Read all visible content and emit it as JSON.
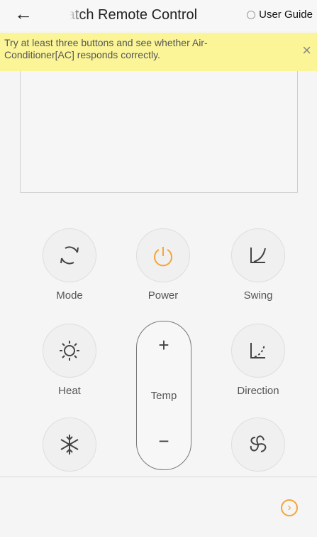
{
  "header": {
    "back_icon": "arrow-left-icon",
    "title": "Match Remote Control",
    "guide_label": "User Guide"
  },
  "notice": {
    "text": "Try at least three buttons and see whether Air-Conditioner[AC] responds correctly.",
    "close_icon": "close-icon"
  },
  "buttons": {
    "mode": "Mode",
    "power": "Power",
    "swing": "Swing",
    "heat": "Heat",
    "direction": "Direction",
    "temp": "Temp",
    "temp_plus": "+",
    "temp_minus": "−"
  },
  "colors": {
    "accent_orange": "#f5a43a",
    "notice_bg": "#fbf598"
  }
}
